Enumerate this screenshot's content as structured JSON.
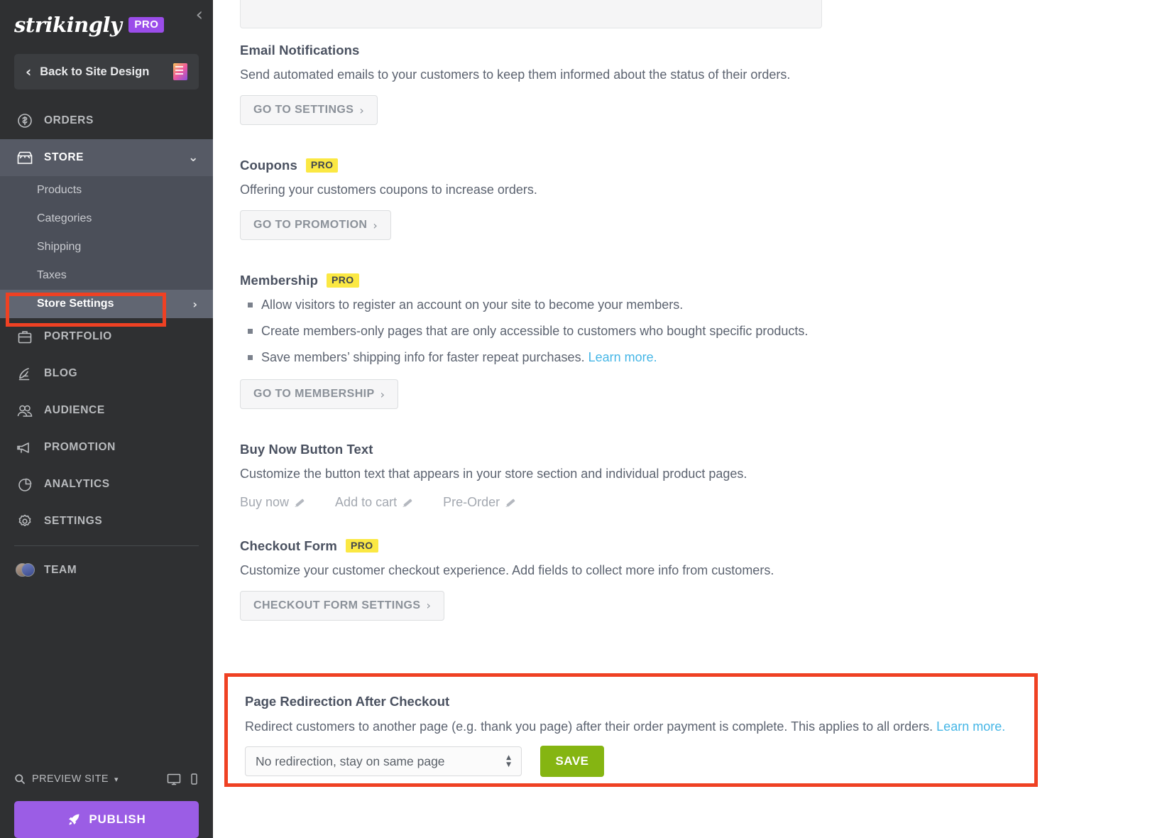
{
  "sidebar": {
    "brand": {
      "name": "strikingly",
      "badge": "PRO"
    },
    "collapse_icon": "chevron-left-icon",
    "back_button": {
      "label": "Back to Site Design",
      "chevron": "‹"
    },
    "nav": [
      {
        "label": "ORDERS",
        "icon": "dollar-circle-icon"
      },
      {
        "label": "STORE",
        "icon": "store-icon",
        "expanded": true,
        "caret": "⌄"
      }
    ],
    "store_subitems": [
      {
        "label": "Products"
      },
      {
        "label": "Categories"
      },
      {
        "label": "Shipping"
      },
      {
        "label": "Taxes"
      },
      {
        "label": "Store Settings",
        "selected": true,
        "caret": "›"
      }
    ],
    "nav_rest": [
      {
        "label": "PORTFOLIO",
        "icon": "briefcase-icon"
      },
      {
        "label": "BLOG",
        "icon": "quill-pen-icon"
      },
      {
        "label": "AUDIENCE",
        "icon": "people-icon"
      },
      {
        "label": "PROMOTION",
        "icon": "megaphone-icon"
      },
      {
        "label": "ANALYTICS",
        "icon": "pie-chart-icon"
      },
      {
        "label": "SETTINGS",
        "icon": "gear-icon"
      }
    ],
    "team": {
      "label": "TEAM",
      "icon": "avatars-icon"
    },
    "footer": {
      "preview_label": "PREVIEW SITE",
      "preview_caret": "▾",
      "search_icon": "search-icon",
      "desktop_icon": "desktop-icon",
      "mobile_icon": "mobile-icon",
      "publish_label": "PUBLISH",
      "publish_icon": "rocket-icon"
    },
    "colors": {
      "accent_purple": "#9b5de5",
      "highlight_red": "#ef4123",
      "active_bg": "#565a65"
    }
  },
  "main": {
    "email_notifications": {
      "title": "Email Notifications",
      "desc": "Send automated emails to your customers to keep them informed about the status of their orders.",
      "button": "GO TO SETTINGS",
      "arrow": "›"
    },
    "coupons": {
      "title": "Coupons",
      "badge": "PRO",
      "desc": "Offering your customers coupons to increase orders.",
      "button": "GO TO PROMOTION",
      "arrow": "›"
    },
    "membership": {
      "title": "Membership",
      "badge": "PRO",
      "bullets": [
        "Allow visitors to register an account on your site to become your members.",
        "Create members-only pages that are only accessible to customers who bought specific products.",
        "Save members’ shipping info for faster repeat purchases. "
      ],
      "learn_more": "Learn more.",
      "button": "GO TO MEMBERSHIP",
      "arrow": "›"
    },
    "buy_now_button_text": {
      "title": "Buy Now Button Text",
      "desc": "Customize the button text that appears in your store section and individual product pages.",
      "options": [
        "Buy now",
        "Add to cart",
        "Pre-Order"
      ],
      "edit_icon": "pencil-icon"
    },
    "checkout_form": {
      "title": "Checkout Form",
      "badge": "PRO",
      "desc": "Customize your customer checkout experience. Add fields to collect more info from customers.",
      "button": "CHECKOUT FORM SETTINGS",
      "arrow": "›"
    },
    "page_redirection": {
      "title": "Page Redirection After Checkout",
      "desc": "Redirect customers to another page (e.g. thank you page) after their order payment is complete. This applies to all orders. ",
      "learn_more": "Learn more.",
      "select_value": "No redirection, stay on same page",
      "save_label": "SAVE",
      "save_color": "#85b512"
    }
  }
}
